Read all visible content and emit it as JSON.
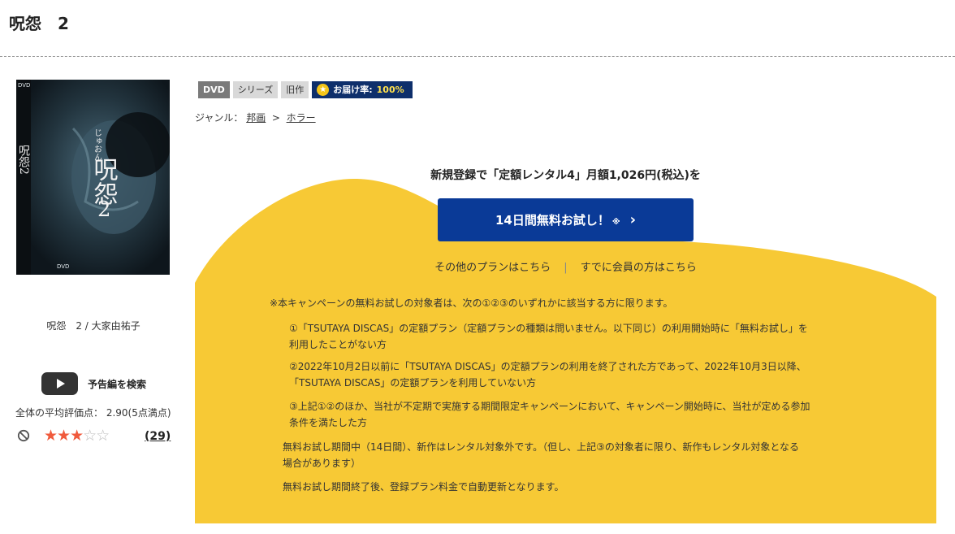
{
  "title": "呪怨　2",
  "cover": {
    "logo_top": "DVD",
    "title_kana": "じゅおん",
    "title_kanji": "呪怨",
    "title_number": "2",
    "title_vertical": "呪怨2",
    "logo_bottom": "DVD"
  },
  "caption": "呪怨　2 / 大家由祐子",
  "trailer": {
    "label": "予告編を検索"
  },
  "rating": {
    "text": "全体の平均評価点：  2.90(5点満点)",
    "stars_on": "★★★",
    "stars_off": "☆☆",
    "count": "(29)"
  },
  "tags": {
    "format": "DVD",
    "series": "シリーズ",
    "old": "旧作",
    "delivery_label": "お届け率:",
    "delivery_rate": "100%"
  },
  "genre": {
    "label": "ジャンル：",
    "level1": "邦画",
    "separator": ">",
    "level2": "ホラー"
  },
  "campaign": {
    "headline": "新規登録で「定額レンタル4」月額1,026円(税込)を",
    "button_label": "14日間無料お試し！",
    "button_note": "※",
    "button_chevron": "›",
    "other_plans": "その他のプランはこちら",
    "separator": "|",
    "members": "すでに会員の方はこちら",
    "terms_intro": "※本キャンペーンの無料お試しの対象者は、次の①②③のいずれかに該当する方に限ります。",
    "term1": "①「TSUTAYA DISCAS」の定額プラン（定額プランの種類は問いません。以下同じ）の利用開始時に「無料お試し」を\n利用したことがない方",
    "term2": "②2022年10月2日以前に「TSUTAYA DISCAS」の定額プランの利用を終了された方であって、2022年10月3日以降、\n「TSUTAYA DISCAS」の定額プランを利用していない方",
    "term3": "③上記①②のほか、当社が不定期で実施する期間限定キャンペーンにおいて、キャンペーン開始時に、当社が定める参加\n条件を満たした方",
    "note1": "無料お試し期間中（14日間）、新作はレンタル対象外です。（但し、上記③の対象者に限り、新作もレンタル対象となる\n場合があります）",
    "note2": "無料お試し期間終了後、登録プラン料金で自動更新となります。"
  },
  "colors": {
    "campaign_yellow": "#f7c935",
    "button_blue": "#0a3a97",
    "delivery_navy": "#0e2f6b",
    "star_red": "#f05a3c"
  }
}
